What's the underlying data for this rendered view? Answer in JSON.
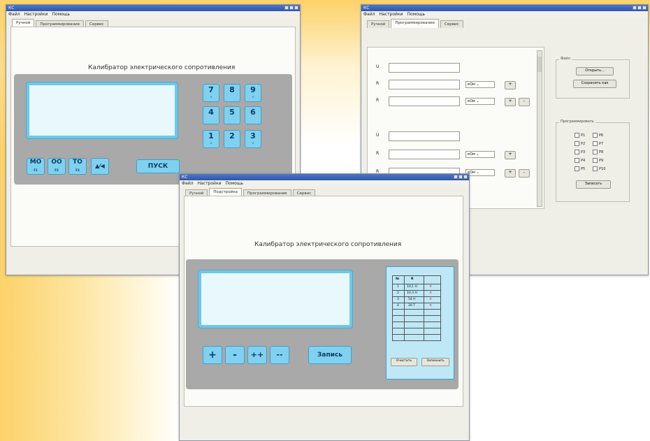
{
  "app": {
    "title": "КС",
    "menu": [
      "Файл",
      "Настройки",
      "Помощь"
    ]
  },
  "win1": {
    "tabs": [
      "Ручной",
      "Программирование",
      "Сервис"
    ],
    "device_title": "Калибратор электрического сопротивления",
    "keypad": [
      {
        "main": "7",
        "sub": "±"
      },
      {
        "main": "8",
        "sub": ""
      },
      {
        "main": "9",
        "sub": "±"
      },
      {
        "main": "4",
        "sub": ""
      },
      {
        "main": "5",
        "sub": ""
      },
      {
        "main": "6",
        "sub": ""
      },
      {
        "main": "1",
        "sub": "±"
      },
      {
        "main": "2",
        "sub": ""
      },
      {
        "main": "3",
        "sub": "±"
      }
    ],
    "fkeys": [
      {
        "main": "MO",
        "sub": "F1"
      },
      {
        "main": "OO",
        "sub": "F2"
      },
      {
        "main": "TO",
        "sub": "F3"
      }
    ],
    "arrow_symbol": "▲⁄◀",
    "start_label": "ПУСК"
  },
  "win2": {
    "tabs": [
      "Ручной",
      "Программирование",
      "Сервис"
    ],
    "rows": [
      {
        "label": "U",
        "unit": "",
        "buttons": []
      },
      {
        "label": "R",
        "unit": "кОм",
        "buttons": [
          "+"
        ]
      },
      {
        "label": "R",
        "unit": "кОм",
        "buttons": [
          "+",
          "-"
        ]
      },
      {
        "label": "U",
        "unit": "",
        "buttons": []
      },
      {
        "label": "R",
        "unit": "кОм",
        "buttons": [
          "+"
        ]
      },
      {
        "label": "R",
        "unit": "кОм",
        "buttons": [
          "+",
          "-"
        ]
      }
    ],
    "file_group": {
      "title": "Файл",
      "open": "Открыть...",
      "save_as": "Сохранить как"
    },
    "program_group": {
      "title": "Программировать",
      "checks": [
        "P1",
        "P6",
        "P2",
        "P7",
        "P3",
        "P8",
        "P4",
        "P9",
        "P5",
        "P10"
      ],
      "write": "Записать"
    }
  },
  "win3": {
    "tabs": [
      "Ручной",
      "Подстройка",
      "Программирование",
      "Сервис"
    ],
    "device_title": "Калибратор электрического сопротивления",
    "buttons": [
      "+",
      "-",
      "++",
      "--"
    ],
    "record": "Запись",
    "table": {
      "headers": [
        "№",
        "R",
        ""
      ],
      "rows": [
        {
          "n": "1",
          "r": "10,1 Н"
        },
        {
          "n": "2",
          "r": "10,3 Н"
        },
        {
          "n": "3",
          "r": "54 Н"
        },
        {
          "n": "4",
          "r": "30 Т"
        }
      ],
      "clear": "Очистить",
      "save": "Запомнить"
    }
  },
  "colors": {
    "accent": "#7fd1ef",
    "device": "#a9a9a9",
    "titlebar": "#3a62b5",
    "lcd": "#e9f8fc"
  }
}
